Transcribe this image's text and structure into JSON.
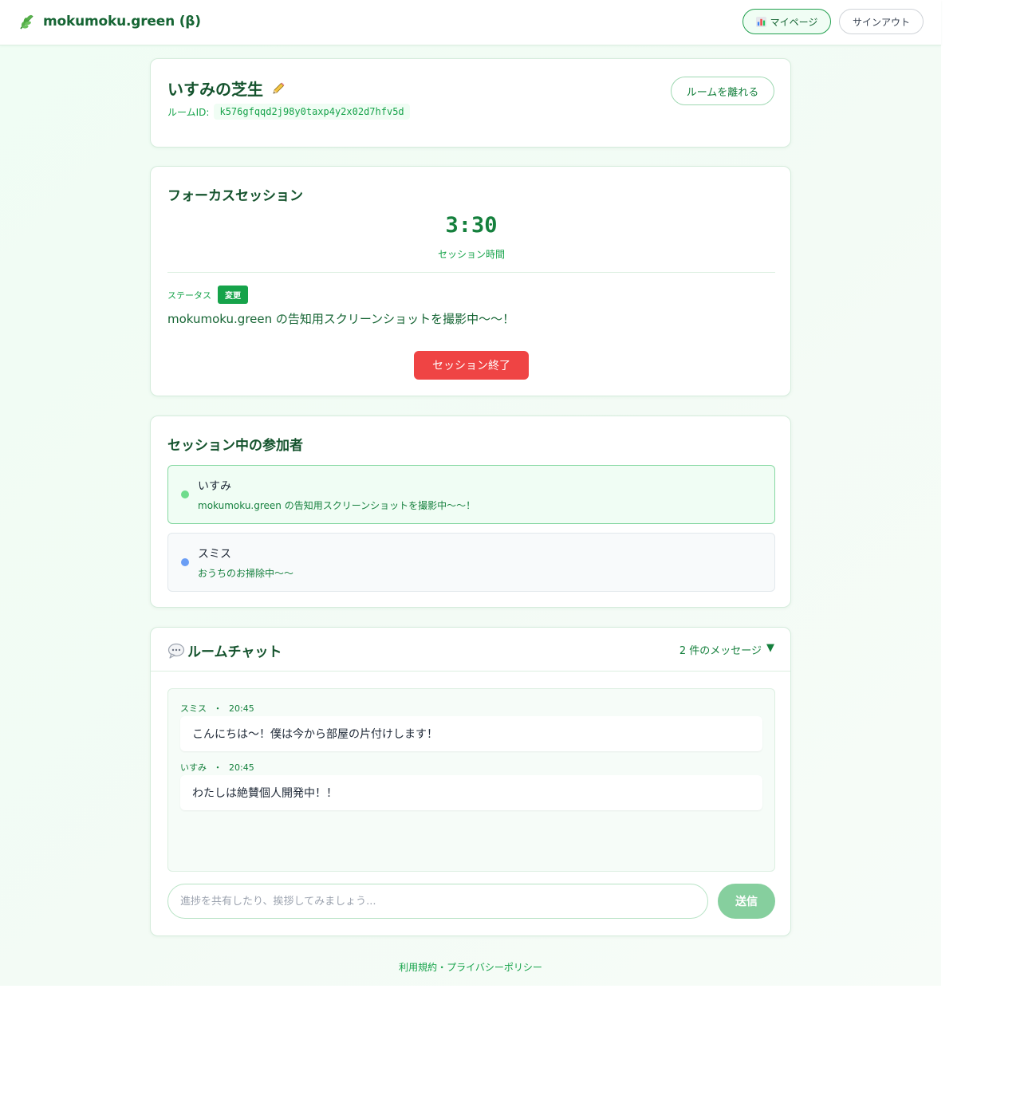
{
  "header": {
    "brand": "mokumoku.green (β)",
    "brand_icon": "leaf-icon",
    "mypage_label": "マイページ",
    "mypage_icon": "bar-chart-icon",
    "signout_label": "サインアウト"
  },
  "room": {
    "name": "いすみの芝生",
    "edit_icon": "pencil-icon",
    "id_label": "ルームID:",
    "id_value": "k576gfqqd2j98y0taxp4y2x02d7hfv5d",
    "leave_label": "ルームを離れる"
  },
  "focus": {
    "title": "フォーカスセッション",
    "timer": "3:30",
    "timer_label": "セッション時間",
    "status_label": "ステータス",
    "change_label": "変更",
    "status_text": "mokumoku.green の告知用スクリーンショットを撮影中〜〜！",
    "end_label": "セッション終了"
  },
  "participants": {
    "title": "セッション中の参加者",
    "items": [
      {
        "name": "いすみ",
        "status": "mokumoku.green の告知用スクリーンショットを撮影中〜〜！",
        "dot_color": "#6fdc8c"
      },
      {
        "name": "スミス",
        "status": "おうちのお掃除中〜〜",
        "dot_color": "#6b9ef5"
      }
    ]
  },
  "chat": {
    "title": "ルームチャット",
    "title_icon": "speech-bubble-icon",
    "count_label": "2 件のメッセージ",
    "toggle": "▼",
    "messages": [
      {
        "author": "スミス",
        "sep": "・",
        "time": "20:45",
        "text": "こんにちは〜！僕は今から部屋の片付けします！"
      },
      {
        "author": "いすみ",
        "sep": "・",
        "time": "20:45",
        "text": "わたしは絶賛個人開発中！！"
      }
    ],
    "input_placeholder": "進捗を共有したり、挨拶してみましょう...",
    "input_value": "",
    "send_label": "送信"
  },
  "footer": {
    "terms": "利用規約",
    "sep": "・",
    "privacy": "プライバシーポリシー"
  },
  "colors": {
    "primary": "#16a34a",
    "danger": "#ef4444",
    "background": "#f0fdf4"
  }
}
